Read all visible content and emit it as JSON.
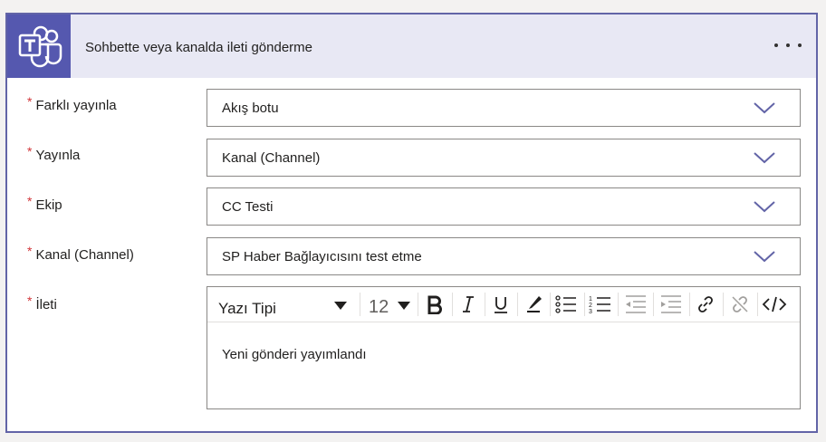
{
  "header": {
    "title": "Sohbette veya kanalda ileti gönderme",
    "logo_icon": "microsoft-teams-logo",
    "more_icon": "more-options-icon",
    "accent_color": "#5558af",
    "header_bg": "#e8e8f4"
  },
  "fields": [
    {
      "label": "Farklı yayınla",
      "required_mark": "*",
      "value": "Akış botu"
    },
    {
      "label": "Yayınla",
      "required_mark": "*",
      "value": "Kanal (Channel)"
    },
    {
      "label": "Ekip",
      "required_mark": "*",
      "value": "CC Testi"
    },
    {
      "label": "Kanal (Channel)",
      "required_mark": "*",
      "value": "SP Haber Bağlayıcısını test etme"
    }
  ],
  "message": {
    "label": "İleti",
    "required_mark": "*",
    "toolbar": {
      "font": "Yazı Tipi",
      "size": "12",
      "buttons": [
        "bold-icon",
        "italic-icon",
        "underline-icon",
        "font-color-icon",
        "bulleted-list-icon",
        "numbered-list-icon",
        "decrease-indent-icon",
        "increase-indent-icon",
        "link-icon",
        "unlink-icon",
        "code-view-icon"
      ]
    },
    "content": "Yeni gönderi yayımlandı"
  }
}
